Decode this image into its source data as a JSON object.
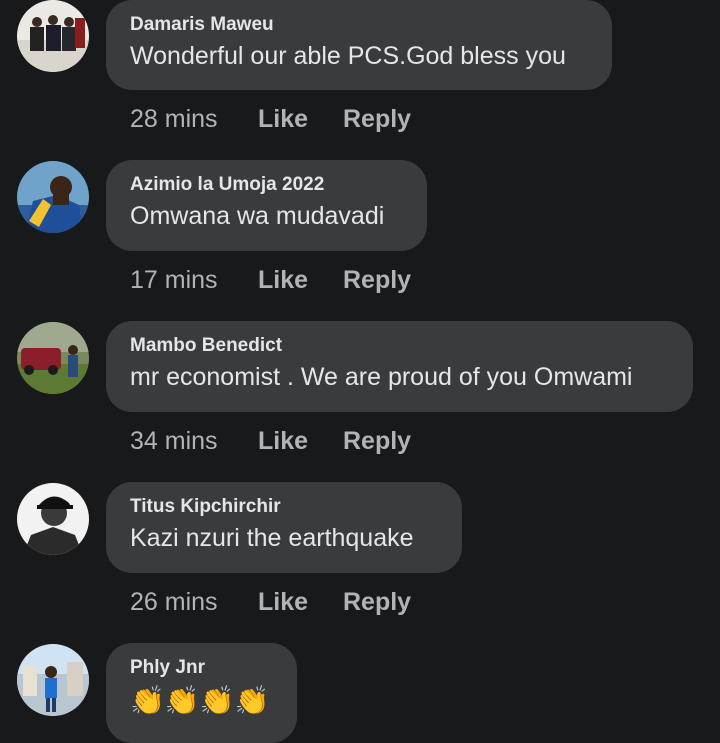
{
  "actions": {
    "like": "Like",
    "reply": "Reply"
  },
  "comments": [
    {
      "author": "Damaris Maweu",
      "text": "Wonderful our able PCS.God bless you",
      "time": "28 mins"
    },
    {
      "author": "Azimio la Umoja 2022",
      "text": "Omwana wa mudavadi",
      "time": "17 mins"
    },
    {
      "author": "Mambo Benedict",
      "text": "mr economist . We are proud of you Omwami",
      "time": "34 mins"
    },
    {
      "author": "Titus Kipchirchir",
      "text": "Kazi nzuri  the earthquake",
      "time": "26 mins"
    },
    {
      "author": "Phly Jnr",
      "text": "👏👏👏👏",
      "time": ""
    }
  ],
  "colors": {
    "background": "#18191a",
    "bubble": "#3a3b3c",
    "text": "#e4e6eb",
    "meta": "#b0b3b8"
  }
}
